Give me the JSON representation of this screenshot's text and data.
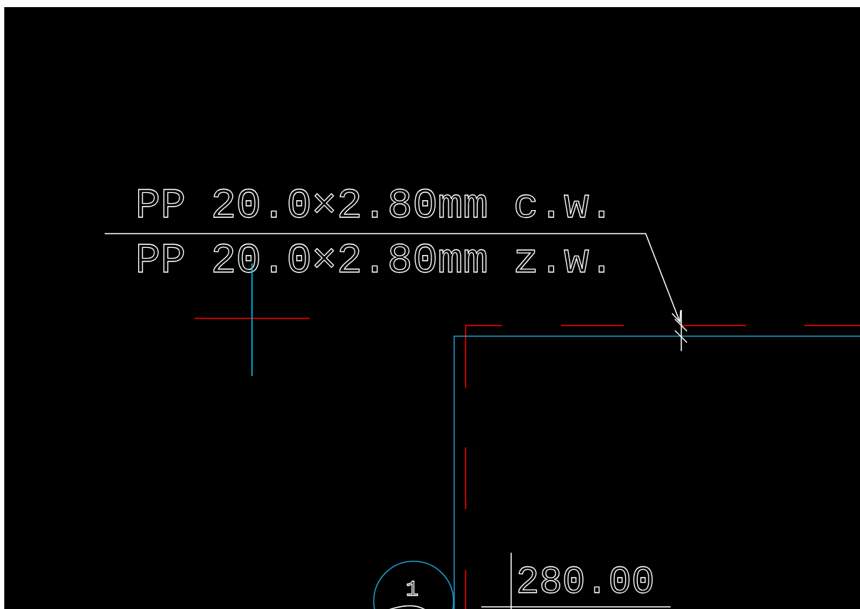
{
  "drawing": {
    "pipe_labels": [
      "PP 20.0×2.80mm c.w.",
      "PP 20.0×2.80mm z.w."
    ],
    "dimension": "280.00",
    "marker": "1"
  }
}
